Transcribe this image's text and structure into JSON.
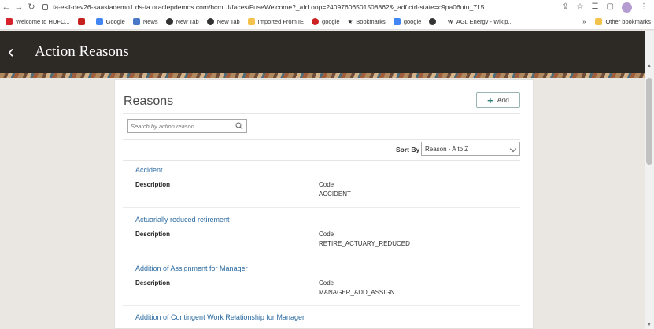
{
  "browser": {
    "url": "fa-esll-dev26-saasfademo1.ds-fa.oraclepdemos.com/hcmUI/faces/FuseWelcome?_afrLoop=24097606501508862&_adf.ctrl-state=c9pa06utu_715",
    "bookmarks": [
      {
        "label": "Welcome to HDFC...",
        "icon": "hdfc-icon",
        "color": "#d5222b"
      },
      {
        "label": "",
        "icon": "gmail-icon",
        "color": "#c5221f"
      },
      {
        "label": "Google",
        "icon": "google-icon",
        "color": "#4285f4"
      },
      {
        "label": "News",
        "icon": "news-icon",
        "color": "#4a78c8"
      },
      {
        "label": "New Tab",
        "icon": "globe-icon",
        "color": "#333333"
      },
      {
        "label": "New Tab",
        "icon": "globe-icon",
        "color": "#333333"
      },
      {
        "label": "Imported From IE",
        "icon": "folder-icon",
        "color": "#f3c24c"
      },
      {
        "label": "google",
        "icon": "red-oval-icon",
        "color": "#cc2222"
      },
      {
        "label": "Bookmarks",
        "icon": "star-icon",
        "color": "#555555"
      },
      {
        "label": "google",
        "icon": "google-icon",
        "color": "#4285f4"
      },
      {
        "label": "",
        "icon": "globe-icon",
        "color": "#333333"
      },
      {
        "label": "AGL Energy - Wikip...",
        "icon": "wikipedia-icon",
        "color": "#222222"
      }
    ],
    "more_label": "»",
    "other_bookmarks": "Other bookmarks"
  },
  "header": {
    "title": "Action Reasons",
    "back_icon": "chevron-left-icon",
    "bg_color": "#2d2a26"
  },
  "card": {
    "title": "Reasons",
    "add_label": "Add",
    "search_placeholder": "Search by action reason",
    "sort_by_label": "Sort By",
    "sort_value": "Reason - A to Z"
  },
  "reasons": [
    {
      "name": "Accident",
      "description_label": "Description",
      "code_label": "Code",
      "code": "ACCIDENT"
    },
    {
      "name": "Actuarially reduced retirement",
      "description_label": "Description",
      "code_label": "Code",
      "code": "RETIRE_ACTUARY_REDUCED"
    },
    {
      "name": "Addition of Assignment for Manager",
      "description_label": "Description",
      "code_label": "Code",
      "code": "MANAGER_ADD_ASSIGN"
    },
    {
      "name": "Addition of Contingent Work Relationship for Manager",
      "description_label": "",
      "code_label": "",
      "code": ""
    }
  ],
  "colors": {
    "link": "#2a6aa0",
    "accent": "#2f7d7a"
  }
}
